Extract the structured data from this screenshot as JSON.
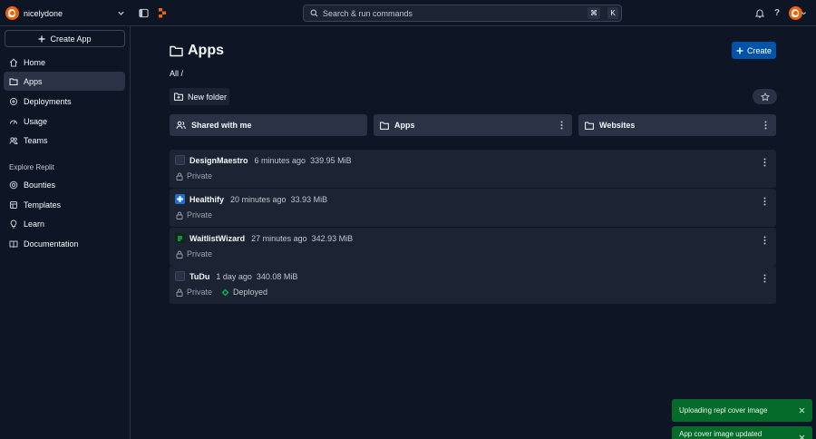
{
  "user": {
    "name": "nicelydone"
  },
  "search": {
    "placeholder": "Search & run commands",
    "shortcut_mod": "⌘",
    "shortcut_key": "K"
  },
  "sidebar": {
    "create_app_label": "Create App",
    "items": [
      {
        "label": "Home",
        "icon": "home-icon"
      },
      {
        "label": "Apps",
        "icon": "folder-icon",
        "active": true
      },
      {
        "label": "Deployments",
        "icon": "deployments-icon"
      },
      {
        "label": "Usage",
        "icon": "usage-icon"
      },
      {
        "label": "Teams",
        "icon": "teams-icon"
      }
    ],
    "explore_label": "Explore Replit",
    "explore_items": [
      {
        "label": "Bounties",
        "icon": "bounties-icon"
      },
      {
        "label": "Templates",
        "icon": "templates-icon"
      },
      {
        "label": "Learn",
        "icon": "learn-icon"
      },
      {
        "label": "Documentation",
        "icon": "documentation-icon"
      }
    ]
  },
  "main": {
    "title": "Apps",
    "create_label": "Create",
    "breadcrumb": "All /",
    "new_folder_label": "New folder",
    "folders": [
      {
        "label": "Shared with me"
      },
      {
        "label": "Apps"
      },
      {
        "label": "Websites"
      }
    ],
    "repls": [
      {
        "name": "DesignMaestro",
        "time": "6 minutes ago",
        "size": "339.95 MiB",
        "privacy": "Private",
        "deployed": ""
      },
      {
        "name": "Healthify",
        "time": "20 minutes ago",
        "size": "33.93 MiB",
        "privacy": "Private",
        "deployed": ""
      },
      {
        "name": "WaitlistWizard",
        "time": "27 minutes ago",
        "size": "342.93 MiB",
        "privacy": "Private",
        "deployed": ""
      },
      {
        "name": "TuDu",
        "time": "1 day ago",
        "size": "340.08 MiB",
        "privacy": "Private",
        "deployed": "Deployed"
      }
    ]
  },
  "toasts": [
    {
      "message": "Uploading repl cover image"
    },
    {
      "message": "App cover image updated successfully"
    }
  ],
  "colors": {
    "background": "#0e1525",
    "surface": "#1c2333",
    "accent": "#0053a6",
    "toast": "#046b2a",
    "brand": "#f26207"
  }
}
